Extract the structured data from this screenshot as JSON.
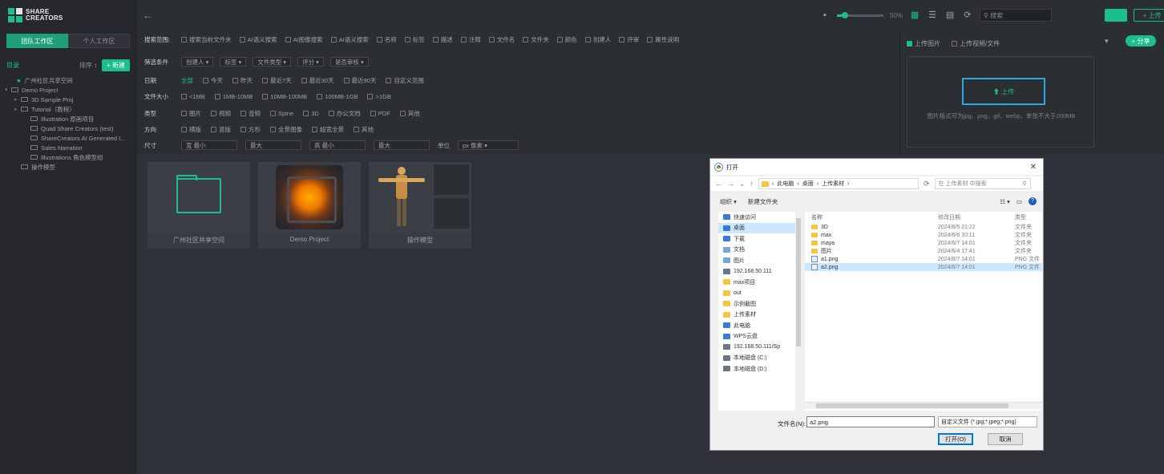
{
  "app": {
    "logo_line1": "SHARE",
    "logo_line2": "CREATORS"
  },
  "sidebar": {
    "tabs": [
      {
        "label": "团队工作区"
      },
      {
        "label": "个人工作区"
      }
    ],
    "section_title": "目录",
    "sort_label": "排序 ↕",
    "new_button": "+ 新建",
    "tree": [
      {
        "label": "广州社区共享空间",
        "toggle": "",
        "star": true,
        "indent": 8
      },
      {
        "label": "Demo Project",
        "toggle": "▾",
        "star": false,
        "indent": 2
      },
      {
        "label": "3D Sample Proj",
        "toggle": "▸",
        "star": false,
        "indent": 14
      },
      {
        "label": "Tutorial（教程）",
        "toggle": "▸",
        "star": false,
        "indent": 14
      },
      {
        "label": "Illustration 原画项目",
        "toggle": "",
        "star": false,
        "indent": 26
      },
      {
        "label": "Quad Share Creators (test)",
        "toggle": "",
        "star": false,
        "indent": 26
      },
      {
        "label": "ShareCreators AI Generated I...",
        "toggle": "",
        "star": false,
        "indent": 26
      },
      {
        "label": "Sales Narration",
        "toggle": "",
        "star": false,
        "indent": 26
      },
      {
        "label": "Illustrations 角色模型组",
        "toggle": "",
        "star": false,
        "indent": 26
      },
      {
        "label": "操作模型",
        "toggle": "",
        "star": false,
        "indent": 14
      }
    ]
  },
  "topbar": {
    "zoom": "50%",
    "search_placeholder": "搜索",
    "upload_label": "+ 上传"
  },
  "filters": {
    "row1_label": "搜索范围:",
    "row1": [
      "搜索当前文件夹",
      "AI语义搜索",
      "AI图像搜索",
      "AI语义搜索",
      "名称",
      "标签",
      "描述",
      "注释",
      "文件名",
      "文件夹",
      "颜色",
      "创建人",
      "评审",
      "属性说明"
    ],
    "row2_label": "筛选条件",
    "row2": [
      "创建人 ▾",
      "标签 ▾",
      "文件类型 ▾",
      "评分 ▾",
      "是否审核 ▾"
    ],
    "row3_label": "日期",
    "row3": [
      "全部",
      "今天",
      "昨天",
      "最近7天",
      "最近30天",
      "最近90天",
      "自定义范围"
    ],
    "row4_label": "文件大小",
    "row4": [
      "<1MB",
      "1MB-10MB",
      "10MB-100MB",
      "100MB-1GB",
      ">1GB"
    ],
    "row5_label": "类型",
    "row5": [
      "图片",
      "视频",
      "音频",
      "Spine",
      "3D",
      "办公文档",
      "PDF",
      "其他"
    ],
    "row6_label": "方向",
    "row6": [
      "横版",
      "竖版",
      "方形",
      "全景图像",
      "超宽全景",
      "其他"
    ],
    "row7_label": "尺寸",
    "row7": [
      "宽 最小",
      "最大",
      "高 最小",
      "最大"
    ],
    "row7_extra": "单位",
    "row7_select": "px 像素 ▾"
  },
  "upload_panel": {
    "tab1": "上传图片",
    "tab2": "上传视频/文件",
    "upload_button": "⬆ 上传",
    "hint": "图片格式可为jpg、png、gif、webp，单张不大于200MB",
    "pill": "+ 分享"
  },
  "cards": [
    {
      "label": "广州社区共享空间",
      "kind": "folder"
    },
    {
      "label": "Demo Project",
      "kind": "cube"
    },
    {
      "label": "操作模型",
      "kind": "figure"
    }
  ],
  "dialog": {
    "title": "打开",
    "breadcrumb": [
      "此电脑",
      "桌面",
      "上传素材"
    ],
    "search_placeholder": "在 上传素材 中搜索",
    "toolbar": [
      "组织 ▾",
      "新建文件夹"
    ],
    "nav": [
      {
        "label": "快速访问",
        "icon": "b"
      },
      {
        "label": "桌面",
        "icon": "b",
        "selected": true
      },
      {
        "label": "下载",
        "icon": "b"
      },
      {
        "label": "文档",
        "icon": "g"
      },
      {
        "label": "图片",
        "icon": "g"
      },
      {
        "label": "192.168.50.111",
        "icon": "d"
      },
      {
        "label": "max项目",
        "icon": "f"
      },
      {
        "label": "out",
        "icon": "f"
      },
      {
        "label": "示例截图",
        "icon": "f"
      },
      {
        "label": "上传素材",
        "icon": "f"
      },
      {
        "label": "此电脑",
        "icon": "b"
      },
      {
        "label": "WPS云盘",
        "icon": "b"
      },
      {
        "label": "192.168.50.111/Sp",
        "icon": "d"
      },
      {
        "label": "本地磁盘 (C:)",
        "icon": "d"
      },
      {
        "label": "本地磁盘 (D:)",
        "icon": "d"
      }
    ],
    "columns": [
      "名称",
      "修改日期",
      "类型"
    ],
    "files": [
      {
        "name": "3D",
        "date": "2024/6/5 21:22",
        "type": "文件夹",
        "icon": "folder"
      },
      {
        "name": "max",
        "date": "2024/6/6 10:11",
        "type": "文件夹",
        "icon": "folder"
      },
      {
        "name": "maya",
        "date": "2024/6/7 14:01",
        "type": "文件夹",
        "icon": "folder"
      },
      {
        "name": "图片",
        "date": "2024/6/4 17:41",
        "type": "文件夹",
        "icon": "folder"
      },
      {
        "name": "a1.png",
        "date": "2024/6/7 14:01",
        "type": "PNG 文件",
        "icon": "png"
      },
      {
        "name": "a2.png",
        "date": "2024/6/7 14:01",
        "type": "PNG 文件",
        "icon": "png",
        "selected": true
      }
    ],
    "filename_label": "文件名(N):",
    "filename_value": "a2.png",
    "filetype": "自定义文件 (*.jpg;*.jpeg;*.png)",
    "open_button": "打开(O)",
    "cancel_button": "取消"
  },
  "colors": {
    "accent": "#1bbf8c",
    "panel": "#2b2e33",
    "sidebar": "#26282d",
    "highlight": "#2aa8e0"
  }
}
